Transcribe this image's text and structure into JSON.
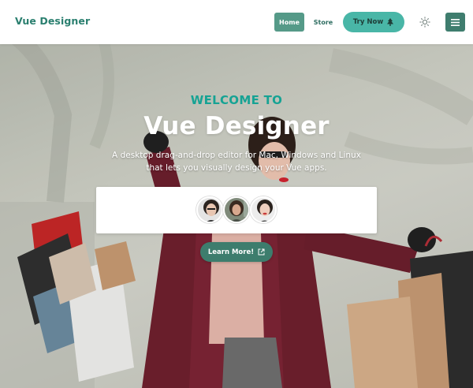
{
  "brand": "Vue Designer",
  "nav": {
    "home": "Home",
    "store": "Store",
    "try_now": "Try Now"
  },
  "hero": {
    "welcome": "WELCOME TO",
    "title": "Vue Designer",
    "subtitle_line1": "A desktop drag-and-drop editor for Mac, Windows and Linux",
    "subtitle_line2": "that lets you visually design your Vue apps.",
    "learn_more": "Learn More!"
  },
  "icons": {
    "try_now": "tree-icon",
    "theme": "sun-icon",
    "menu": "hamburger-menu-icon",
    "learn_more": "external-link-icon"
  },
  "colors": {
    "brand": "#2a7f6f",
    "accent": "#49b6a7",
    "welcome": "#16a394",
    "button_dark": "#3d7d6d"
  }
}
